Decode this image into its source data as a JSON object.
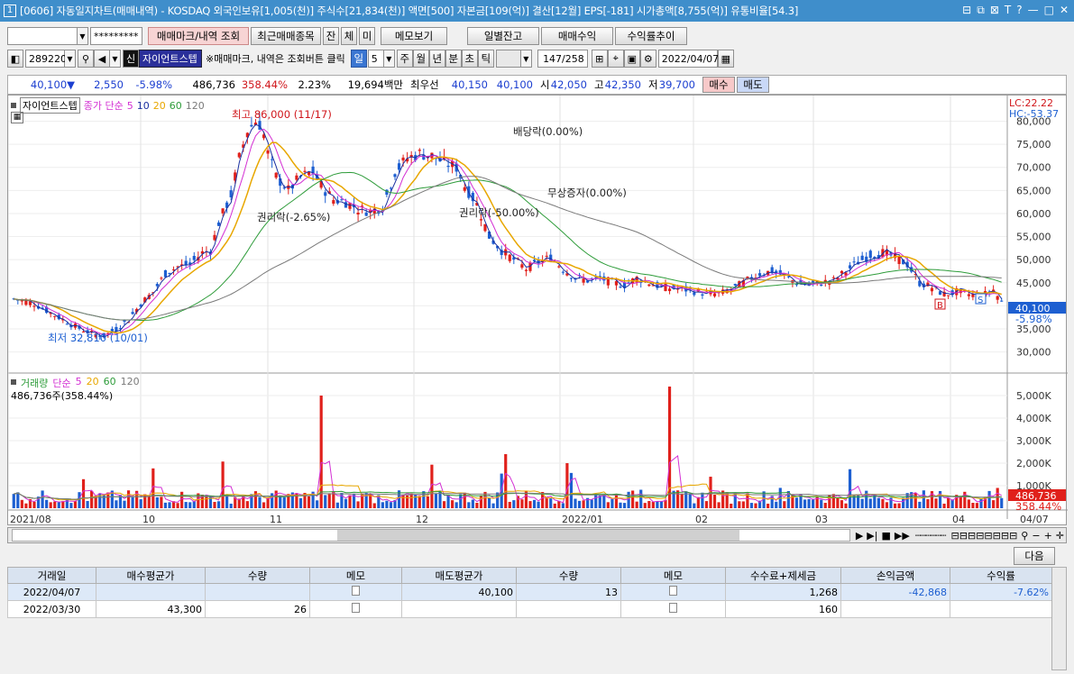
{
  "titlebar": {
    "num": "1",
    "title": "[0606] 자동일지차트(매매내역) - KOSDAQ 외국인보유[1,005(천)] 주식수[21,834(천)] 액면[500] 자본금[109(억)] 결산[12월] EPS[-181] 시가총액[8,755(억)] 유통비율[54.3]",
    "icons": [
      "⊟",
      "⧉",
      "⊠",
      "T",
      "?",
      "—",
      "□",
      "✕"
    ]
  },
  "toolbar": {
    "account": "",
    "password": "*********",
    "btn_trade": "매매마크/내역 조회",
    "btn_recent": "최근매매종목",
    "btn_jan": "잔",
    "btn_che": "체",
    "btn_mi": "미",
    "btn_memo": "메모보기",
    "btn_daily": "일별잔고",
    "btn_profit": "매매수익",
    "btn_yield": "수익률추이"
  },
  "stockbar": {
    "code": "289220",
    "name": "자이언트스텝",
    "hint": "※매매마크, 내역은 조회버튼 클릭",
    "period": "일",
    "period_num": "5",
    "periods": [
      "주",
      "월",
      "년",
      "분",
      "초",
      "틱"
    ],
    "count": "147/258",
    "date": "2022/04/07"
  },
  "quote": {
    "price": "40,100",
    "arrow": "▼",
    "change": "2,550",
    "change_pct": "-5.98%",
    "volume": "486,736",
    "vol_pct": "358.44%",
    "turnover": "2.23%",
    "amount": "19,694백만",
    "pref": "최우선",
    "ask": "40,150",
    "bid": "40,100",
    "open_label": "시",
    "open": "42,050",
    "high_label": "고",
    "high": "42,350",
    "low_label": "저",
    "low": "39,700",
    "buy": "매수",
    "sell": "매도"
  },
  "chart": {
    "legend_name": "자이언트스텝",
    "legend_ma": "종가 단순",
    "ma": [
      "5",
      "10",
      "20",
      "60",
      "120"
    ],
    "lc": "LC:22.22",
    "hc": "HC:-53.37",
    "max_label": "최고 86,000 (11/17)",
    "min_label": "최저 32,810 (10/01)",
    "div_label": "배당락(0.00%)",
    "rights_label": "권리락(-2.65%)",
    "bonus_label": "무상증자(0.00%)",
    "split_label": "권리락(-50.00%)",
    "price_ticks": [
      "80,000",
      "75,000",
      "70,000",
      "65,000",
      "60,000",
      "55,000",
      "50,000",
      "45,000",
      "40,000",
      "35,000",
      "30,000"
    ],
    "last_price": "40,100",
    "last_pct": "-5.98%",
    "vol_legend": "거래량",
    "vol_ma_label": "단순",
    "vol_ma": [
      "5",
      "20",
      "60",
      "120"
    ],
    "vol_current": "486,736주(358.44%)",
    "vol_ticks": [
      "5,000K",
      "4,000K",
      "3,000K",
      "2,000K",
      "1,000K"
    ],
    "last_vol": "486,736",
    "last_vol_pct": "358.44%",
    "dates": [
      "2021/08",
      "10",
      "11",
      "12",
      "2022/01",
      "02",
      "03",
      "04",
      "04/07"
    ]
  },
  "colors": {
    "up": "#e0201b",
    "down": "#1d5fd1",
    "ma5": "#1a2fa0",
    "ma10": "#d32fd3",
    "ma20": "#e8a700",
    "ma60": "#2e9c3a",
    "ma120": "#7a7a7a"
  },
  "next_button": "다음",
  "table": {
    "headers": [
      "거래일",
      "매수평균가",
      "수량",
      "메모",
      "매도평균가",
      "수량",
      "메모",
      "수수료+제세금",
      "손익금액",
      "수익률"
    ],
    "rows": [
      [
        "2022/04/07",
        "",
        "",
        "",
        "40,100",
        "13",
        "",
        "1,268",
        "-42,868",
        "-7.62%"
      ],
      [
        "2022/03/30",
        "43,300",
        "26",
        "",
        "",
        "",
        "",
        "160",
        "",
        ""
      ]
    ]
  }
}
